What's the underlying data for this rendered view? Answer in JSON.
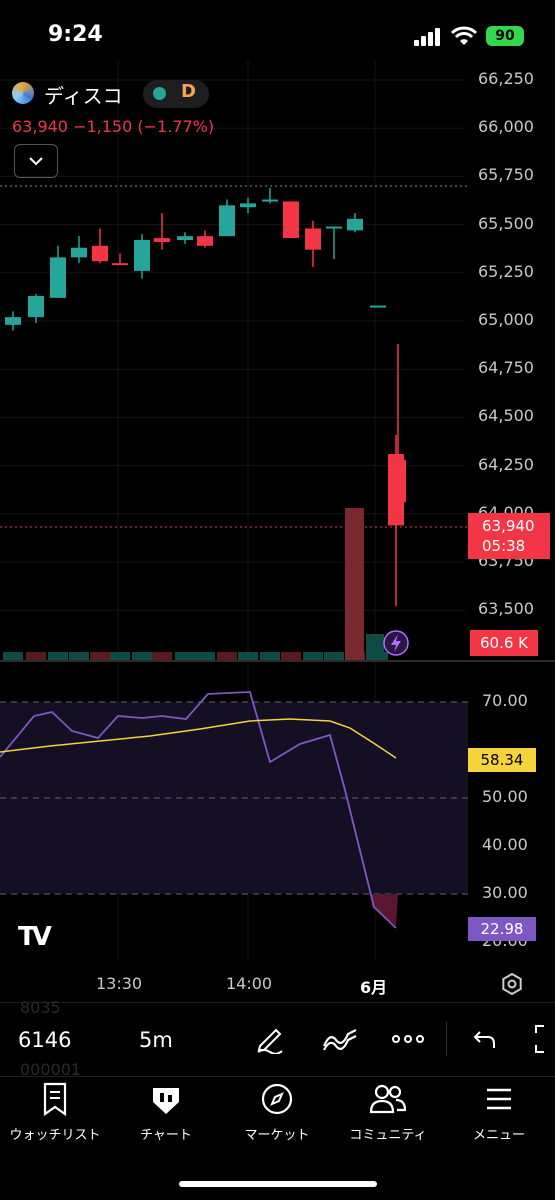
{
  "status_bar": {
    "time": "9:24",
    "battery": "90"
  },
  "header": {
    "symbol_name": "ディスコ",
    "badge": "D",
    "quote": "63,940  −1,150 (−1.77%)"
  },
  "price_axis": {
    "labels": [
      "66,250",
      "66,000",
      "65,750",
      "65,500",
      "65,250",
      "65,000",
      "64,750",
      "64,500",
      "64,250",
      "64,000",
      "63,750",
      "63,500"
    ]
  },
  "last_price": {
    "price": "63,940",
    "countdown": "05:38"
  },
  "volume_label": "60.6 K",
  "rsi": {
    "axis_labels": [
      "70.00",
      "50.00",
      "40.00",
      "30.00",
      "20.00"
    ],
    "ma_value": "58.34",
    "current": "22.98"
  },
  "time_axis": {
    "labels": [
      "13:30",
      "14:00",
      "6月"
    ]
  },
  "toolbar": {
    "symbol": "6146",
    "interval": "5m",
    "ghost_top": "8035",
    "ghost_bottom": "000001"
  },
  "bottom_nav": [
    {
      "label": "ウォッチリスト",
      "icon": "bookmark-icon"
    },
    {
      "label": "チャート",
      "icon": "chart-icon"
    },
    {
      "label": "マーケット",
      "icon": "compass-icon"
    },
    {
      "label": "コミュニティ",
      "icon": "users-icon"
    },
    {
      "label": "メニュー",
      "icon": "menu-icon"
    }
  ],
  "colors": {
    "up": "#26a69a",
    "down": "#f23645",
    "rsi_line": "#7e57c2",
    "rsi_ma": "#f5d33b"
  },
  "chart_data": {
    "type": "candlestick",
    "price_ylim": [
      63400,
      66300
    ],
    "candles": [
      {
        "o": 64980,
        "h": 65050,
        "l": 64950,
        "c": 65020
      },
      {
        "o": 65020,
        "h": 65140,
        "l": 64990,
        "c": 65130
      },
      {
        "o": 65120,
        "h": 65390,
        "l": 65120,
        "c": 65330
      },
      {
        "o": 65330,
        "h": 65440,
        "l": 65300,
        "c": 65380
      },
      {
        "o": 65390,
        "h": 65480,
        "l": 65300,
        "c": 65310
      },
      {
        "o": 65300,
        "h": 65350,
        "l": 65290,
        "c": 65290
      },
      {
        "o": 65260,
        "h": 65450,
        "l": 65220,
        "c": 65420
      },
      {
        "o": 65430,
        "h": 65560,
        "l": 65370,
        "c": 65410
      },
      {
        "o": 65420,
        "h": 65460,
        "l": 65400,
        "c": 65440
      },
      {
        "o": 65440,
        "h": 65470,
        "l": 65380,
        "c": 65390
      },
      {
        "o": 65440,
        "h": 65630,
        "l": 65440,
        "c": 65600
      },
      {
        "o": 65590,
        "h": 65640,
        "l": 65560,
        "c": 65610
      },
      {
        "o": 65620,
        "h": 65690,
        "l": 65610,
        "c": 65630
      },
      {
        "o": 65620,
        "h": 65600,
        "l": 65430,
        "c": 65430
      },
      {
        "o": 65480,
        "h": 65520,
        "l": 65280,
        "c": 65370
      },
      {
        "o": 65480,
        "h": 65490,
        "l": 65320,
        "c": 65490
      },
      {
        "o": 65470,
        "h": 65560,
        "l": 65460,
        "c": 65530
      },
      {
        "o": 65080,
        "h": 65080,
        "l": 65080,
        "c": 65080
      },
      {
        "o": 64280,
        "h": 64880,
        "l": 64020,
        "c": 64060
      },
      {
        "o": 64310,
        "h": 64410,
        "l": 63520,
        "c": 63940
      }
    ],
    "volume": [
      1,
      1,
      1,
      1,
      1,
      1,
      1,
      1,
      1,
      1,
      1,
      1,
      1,
      1,
      1,
      1,
      1,
      1,
      22,
      4
    ],
    "rsi_ylim": [
      18,
      73
    ],
    "rsi_line": [
      60,
      68,
      69,
      65,
      63,
      68,
      67,
      67,
      68,
      71,
      72,
      72,
      60,
      64,
      62,
      64,
      33,
      25,
      22.98
    ],
    "rsi_ma": [
      61.5,
      62,
      62.5,
      63,
      63.5,
      64,
      64.5,
      65,
      65.5,
      66,
      66.3,
      66.5,
      66.7,
      66.6,
      66,
      64,
      61,
      58.34
    ],
    "rsi_levels": [
      70,
      50,
      30
    ]
  }
}
